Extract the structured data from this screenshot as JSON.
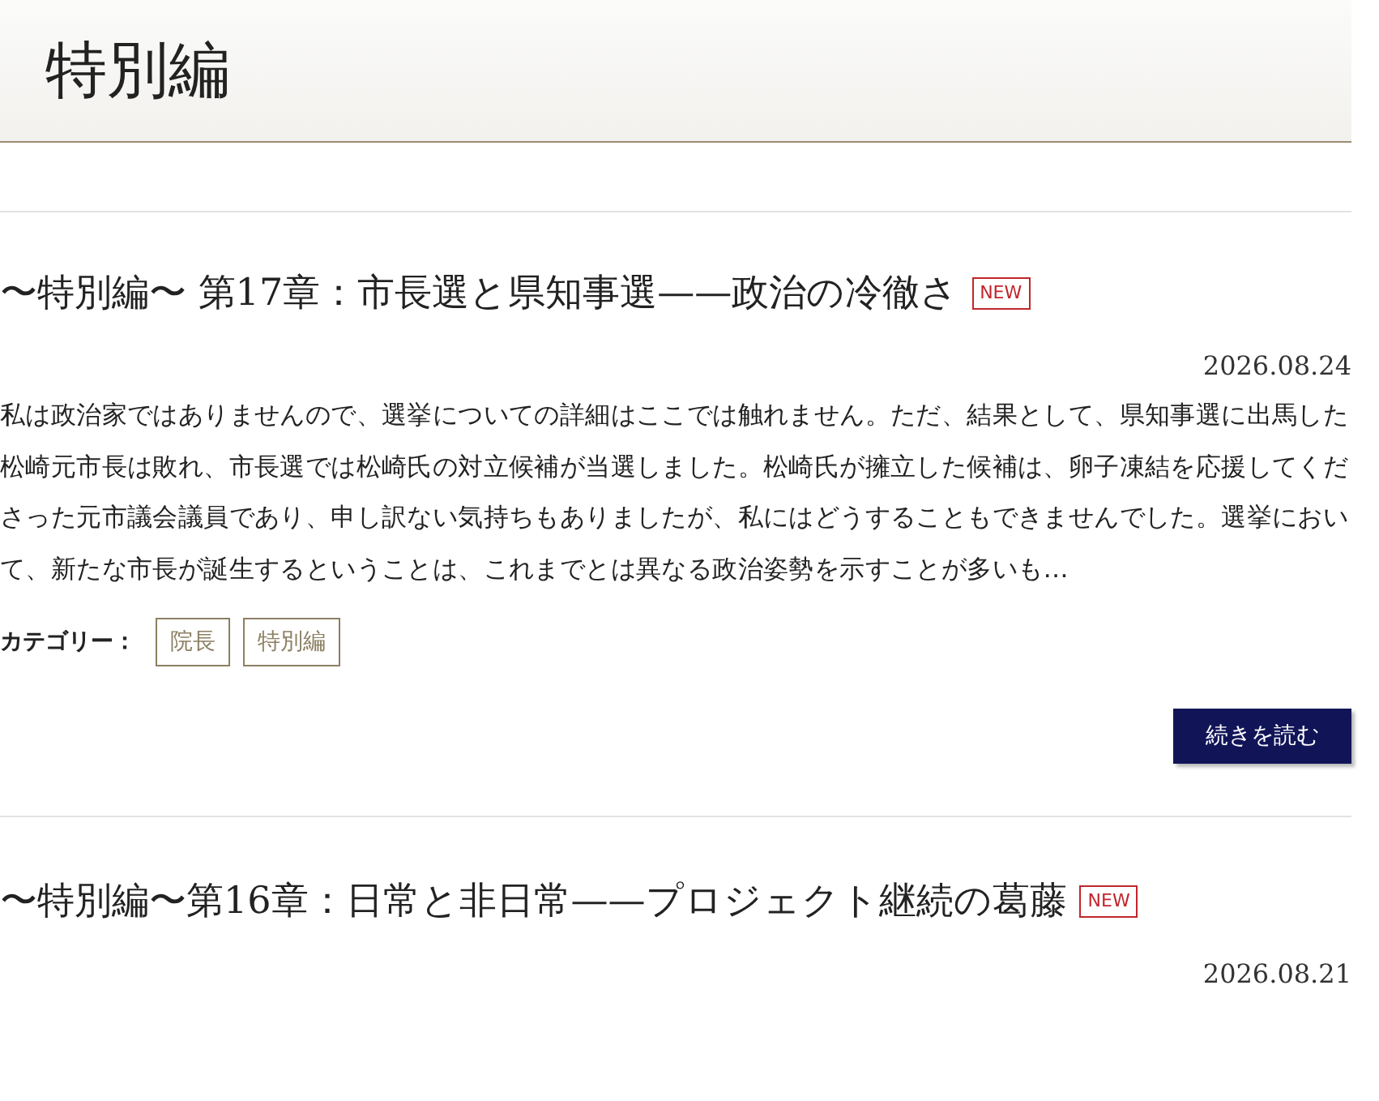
{
  "page_title": "特別編",
  "posts": [
    {
      "title": "〜特別編〜 第17章：市長選と県知事選——政治の冷徹さ",
      "badge": "NEW",
      "date": "2026.08.24",
      "excerpt": "私は政治家ではありませんので、選挙についての詳細はここでは触れません。ただ、結果として、県知事選に出馬した松崎元市長は敗れ、市長選では松崎氏の対立候補が当選しました。松崎氏が擁立した候補は、卵子凍結を応援してくださった元市議会議員であり、申し訳ない気持ちもありましたが、私にはどうすることもできませんでした。選挙において、新たな市長が誕生するということは、これまでとは異なる政治姿勢を示すことが多いも…",
      "category_label": "カテゴリー：",
      "categories": [
        "院長",
        "特別編"
      ],
      "button": "続きを読む"
    },
    {
      "title": "〜特別編〜第16章：日常と非日常——プロジェクト継続の葛藤",
      "badge": "NEW",
      "date": "2026.08.21"
    }
  ]
}
